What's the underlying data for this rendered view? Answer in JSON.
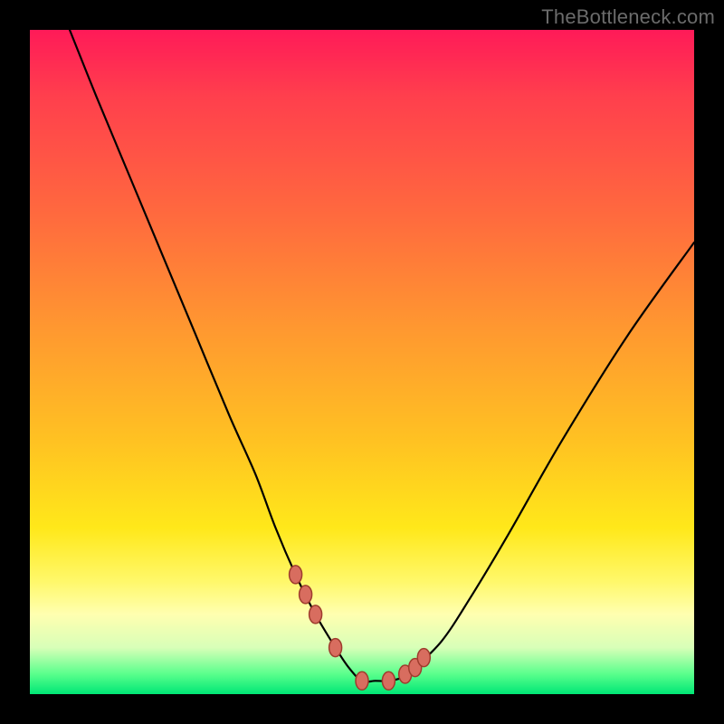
{
  "watermark": "TheBottleneck.com",
  "chart_data": {
    "type": "line",
    "title": "",
    "xlabel": "",
    "ylabel": "",
    "xlim": [
      0,
      100
    ],
    "ylim": [
      0,
      100
    ],
    "grid": false,
    "legend": false,
    "background_gradient": [
      "#ff1a58",
      "#ff6a3e",
      "#ffc222",
      "#ffe81a",
      "#fff86a",
      "#d8ffb8",
      "#00e676"
    ],
    "series": [
      {
        "name": "bottleneck-curve",
        "color": "#000000",
        "x": [
          6,
          10,
          15,
          20,
          25,
          30,
          34,
          37,
          40,
          43,
          46,
          48,
          50,
          52,
          54,
          56,
          58,
          62,
          66,
          72,
          80,
          90,
          100
        ],
        "y": [
          100,
          90,
          78,
          66,
          54,
          42,
          33,
          25,
          18,
          12,
          7,
          4,
          2,
          2,
          2,
          2.5,
          4,
          8,
          14,
          24,
          38,
          54,
          68
        ]
      }
    ],
    "markers": {
      "name": "trough-markers",
      "color": "#d86d5f",
      "x": [
        40.0,
        41.5,
        43.0,
        46.0,
        50.0,
        54.0,
        56.5,
        58.0,
        59.3
      ],
      "y": [
        18.0,
        15.0,
        12.0,
        7.0,
        2.0,
        2.0,
        3.0,
        4.0,
        5.5
      ]
    },
    "annotations": []
  }
}
